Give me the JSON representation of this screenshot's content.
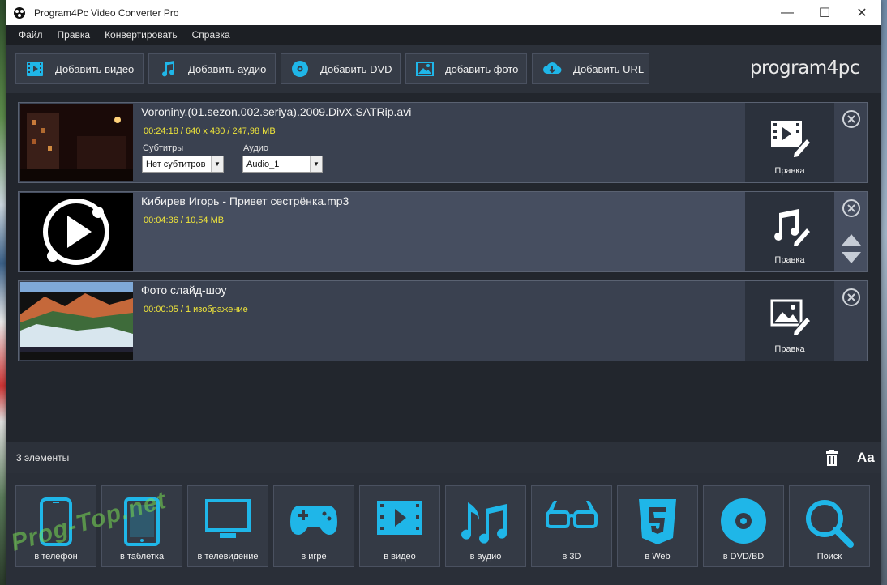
{
  "window": {
    "title": "Program4Pc Video Converter Pro"
  },
  "menu": [
    "Файл",
    "Правка",
    "Конвертировать",
    "Справка"
  ],
  "toolbar": {
    "add_video": "Добавить видео",
    "add_audio": "Добавить аудио",
    "add_dvd": "Добавить DVD",
    "add_photo": "добавить фото",
    "add_url": "Добавить URL",
    "logo": "program4pc"
  },
  "items": [
    {
      "name": "Voroniny.(01.sezon.002.seriya).2009.DivX.SATRip.avi",
      "meta": "00:24:18   /   640 x 480   /   247,98 MB",
      "subtitles_label": "Субтитры",
      "subtitles_value": "Нет субтитров",
      "audio_label": "Аудио",
      "audio_value": "Audio_1",
      "edit_label": "Правка"
    },
    {
      "name": "Кибирев Игорь - Привет сестрёнка.mp3",
      "meta": "00:04:36   /   10,54 MB",
      "edit_label": "Правка"
    },
    {
      "name": "Фото слайд-шоу",
      "meta": "00:00:05   /   1 изображение",
      "edit_label": "Правка"
    }
  ],
  "status": {
    "count": "3 элементы",
    "font_btn": "Aa"
  },
  "categories": [
    {
      "label": "в телефон",
      "icon": "phone-icon"
    },
    {
      "label": "в таблетка",
      "icon": "tablet-icon"
    },
    {
      "label": "в телевидение",
      "icon": "tv-icon"
    },
    {
      "label": "в игре",
      "icon": "gamepad-icon"
    },
    {
      "label": "в видео",
      "icon": "video-icon"
    },
    {
      "label": "в аудио",
      "icon": "music-icon"
    },
    {
      "label": "в 3D",
      "icon": "3d-glasses-icon"
    },
    {
      "label": "в Web",
      "icon": "html5-icon"
    },
    {
      "label": "в DVD/BD",
      "icon": "disc-icon"
    },
    {
      "label": "Поиск",
      "icon": "search-icon"
    }
  ],
  "watermark": "Prog-Top.net",
  "colors": {
    "accent": "#1fb6e8",
    "meta_yellow": "#f0e63a",
    "panel": "#2c313a"
  }
}
